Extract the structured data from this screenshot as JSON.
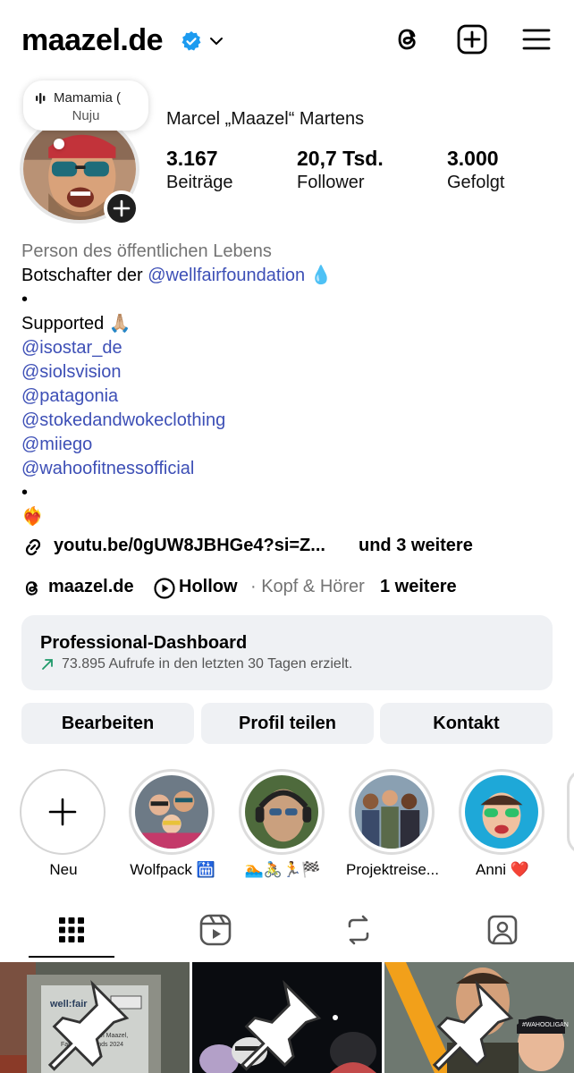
{
  "header": {
    "username": "maazel.de",
    "icons": [
      "verified-badge-icon",
      "chevron-down-icon",
      "threads-icon",
      "create-post-icon",
      "menu-icon"
    ]
  },
  "note": {
    "line1": "Mamamia (",
    "line2": "Nuju"
  },
  "profile": {
    "full_name": "Marcel „Maazel“ Martens",
    "stats": [
      {
        "value": "3.167",
        "label": "Beiträge"
      },
      {
        "value": "20,7 Tsd.",
        "label": "Follower"
      },
      {
        "value": "3.000",
        "label": "Gefolgt"
      }
    ]
  },
  "bio": {
    "category": "Person des öffentlichen Lebens",
    "line1_text": "Botschafter der ",
    "line1_link": "@wellfairfoundation",
    "line1_emoji": "💧",
    "dot1": "•",
    "supported": "Supported 🙏🏼",
    "links": [
      "@isostar_de",
      "@siolsvision",
      "@patagonia",
      "@stokedandwokeclothing",
      "@miiego",
      "@wahoofitnessofficial"
    ],
    "dot2": "•",
    "heart": "❤️‍🔥"
  },
  "external_link": {
    "url": "youtu.be/0gUW8JBHGe4?si=Z...",
    "more": "und 3 weitere"
  },
  "threads_row": {
    "threads_handle": "maazel.de",
    "music_title": "Hollow",
    "music_artist": "· Kopf & Hörer",
    "more": "1 weitere"
  },
  "dashboard": {
    "title": "Professional-Dashboard",
    "subtitle": "73.895 Aufrufe in den letzten 30 Tagen erzielt."
  },
  "buttons": {
    "edit": "Bearbeiten",
    "share": "Profil teilen",
    "contact": "Kontakt"
  },
  "highlights": [
    {
      "label": "Neu"
    },
    {
      "label": "Wolfpack 🛗"
    },
    {
      "label": "🏊🚴🏃🏁"
    },
    {
      "label": "Projektreise..."
    },
    {
      "label": "Anni ❤️"
    }
  ],
  "tabs": [
    "grid-icon",
    "reels-icon",
    "reposts-icon",
    "tagged-icon"
  ],
  "posts": [
    {
      "caption": "With love from Maazel, Family & Friends 2024",
      "brand": "well:fair",
      "pinned": true
    },
    {
      "pinned": true
    },
    {
      "tag": "#WAHOOLIGAN",
      "pinned": true
    }
  ]
}
